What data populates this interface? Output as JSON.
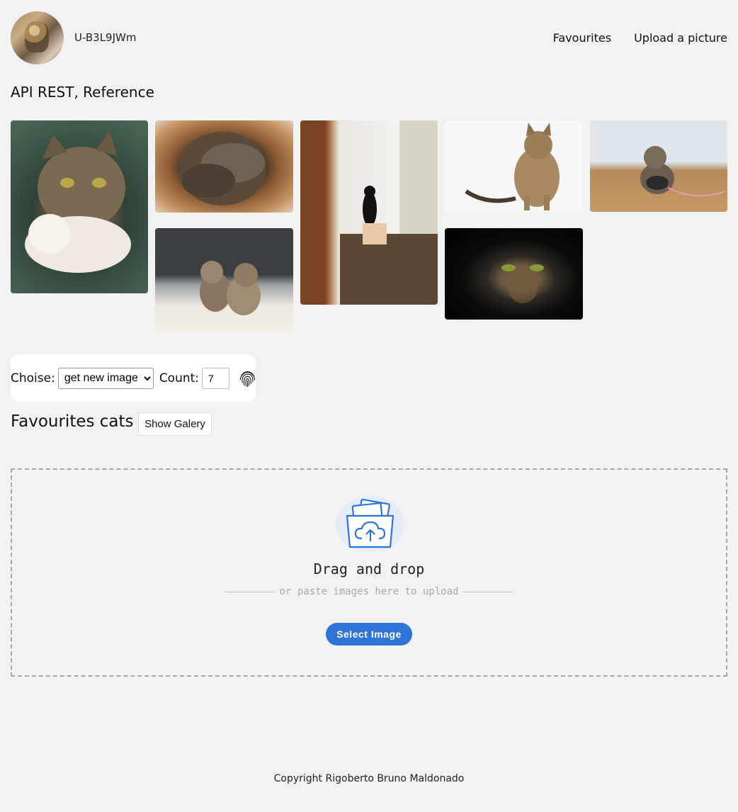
{
  "header": {
    "username": "U-B3L9JWm",
    "nav": {
      "favourites": "Favourites",
      "upload": "Upload a picture"
    }
  },
  "reference": {
    "title": "API REST, Reference"
  },
  "gallery": {
    "images": [
      {
        "name": "cat-and-kitten"
      },
      {
        "name": "kittens-in-basket"
      },
      {
        "name": "cat-climbing-door"
      },
      {
        "name": "bengal-cat-sitting"
      },
      {
        "name": "kitten-with-yarn"
      },
      {
        "name": "two-kittens"
      },
      {
        "name": "cat-in-dark"
      }
    ]
  },
  "controls": {
    "choise_label": "Choise:",
    "select_value": "get new image",
    "count_label": "Count:",
    "count_value": "7"
  },
  "favourites": {
    "title": "Favourites cats",
    "show_galery": "Show Galery"
  },
  "dropzone": {
    "title": "Drag and drop",
    "subtitle": "or paste images here to upload",
    "button": "Select Image"
  },
  "footer": {
    "copyright": "Copyright Rigoberto Bruno Maldonado"
  },
  "colors": {
    "accent": "#2f74d8",
    "background": "#f2f2f2"
  }
}
